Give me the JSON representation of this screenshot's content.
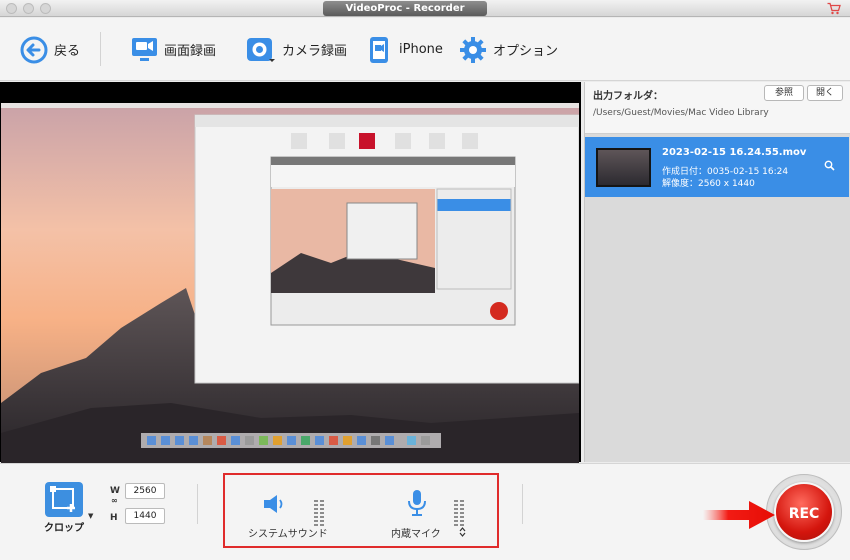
{
  "window": {
    "title": "VideoProc - Recorder",
    "cart_icon": "cart-icon"
  },
  "toolbar": {
    "back": {
      "label": "戻る",
      "icon": "back-arrow-icon"
    },
    "screen_record": {
      "label": "画面録画",
      "icon": "monitor-icon"
    },
    "camera_record": {
      "label": "カメラ録画",
      "icon": "camera-icon"
    },
    "iphone": {
      "label": "iPhone",
      "icon": "iphone-icon"
    },
    "options": {
      "label": "オプション",
      "icon": "gear-icon"
    }
  },
  "output": {
    "label": "出力フォルダ：",
    "browse_label": "参照",
    "open_label": "開く",
    "path": "/Users/Guest/Movies/Mac Video Library"
  },
  "files": [
    {
      "name": "2023-02-15 16.24.55.mov",
      "created": "作成日付：0035-02-15 16:24",
      "resolution": "解像度：2560 x 1440"
    }
  ],
  "crop": {
    "label": "クロップ",
    "width_label": "W",
    "height_label": "H",
    "width": "2560",
    "height": "1440"
  },
  "audio": {
    "system_sound": "システムサウンド",
    "mic": "内蔵マイク"
  },
  "rec": {
    "label": "REC"
  },
  "colors": {
    "accent": "#3a8ee6",
    "rec": "#d4150d",
    "highlight": "#e02b2b"
  }
}
